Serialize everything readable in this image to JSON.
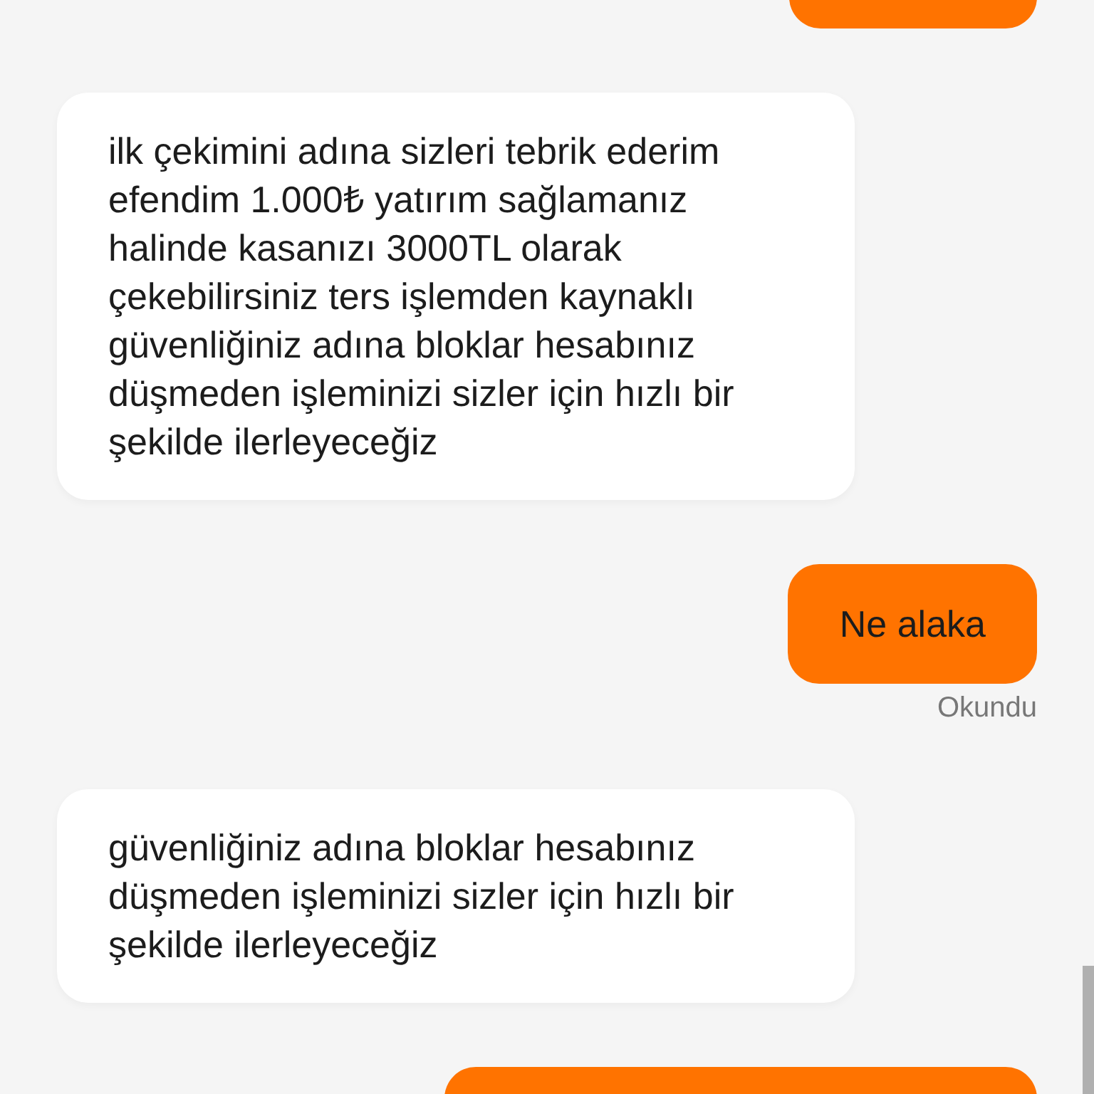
{
  "messages": [
    {
      "kind": "sent"
    },
    {
      "kind": "received",
      "text": "ilk çekimini adına sizleri tebrik ederim efendim 1.000₺ yatırım sağlamanız halinde kasanızı 3000TL olarak çekebilirsiniz ters işlemden kaynaklı güvenliğiniz adına bloklar hesabınız düşmeden işleminizi sizler için hızlı bir şekilde ilerleyeceğiz"
    },
    {
      "kind": "sent",
      "text": "Ne alaka",
      "status": "Okundu"
    },
    {
      "kind": "received",
      "text": "güvenliğiniz adına bloklar hesabınız düşmeden işleminizi sizler için hızlı bir şekilde ilerleyeceğiz"
    },
    {
      "kind": "sent"
    }
  ]
}
